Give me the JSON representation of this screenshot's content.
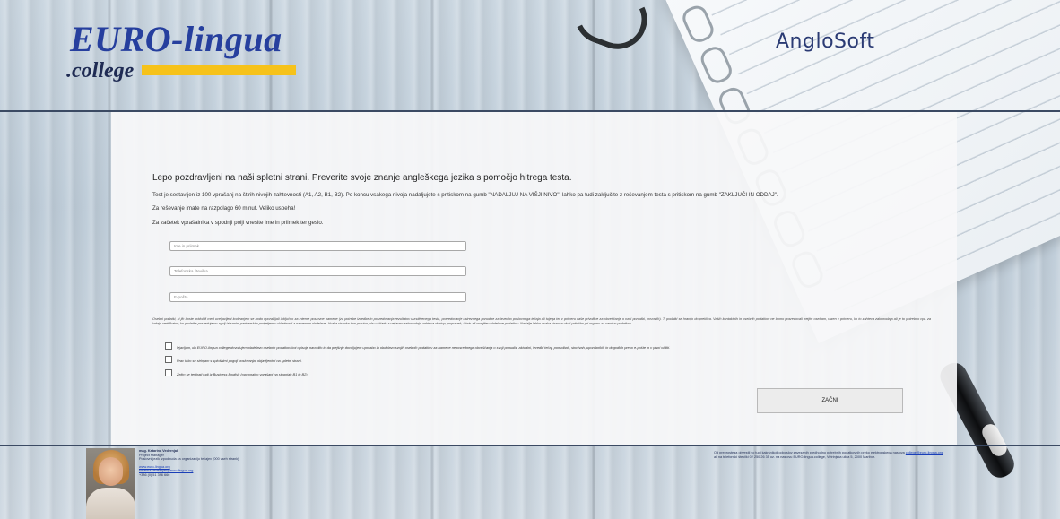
{
  "header": {
    "logo_main": "EURO-lingua",
    "logo_sub": ".college",
    "partner": "AngloSoft"
  },
  "intro": {
    "title": "Lepo pozdravljeni na naši spletni strani. Preverite svoje znanje angleškega jezika s pomočjo hitrega testa.",
    "p1": "Test je sestavljen iz 100 vprašanj na štirih nivojih zahtevnosti (A1, A2, B1, B2). Po koncu vsakega nivoja nadaljujete s pritiskom na gumb \"NADALJUJ NA VIŠJI NIVO\", lahko pa tudi zaključite z reševanjem testa s pritiskom na gumb \"ZAKLJUČI IN ODDAJ\".",
    "p2": "Za reševanje imate na razpolago 60 minut. Veliko uspeha!",
    "p3": "Za začetek vprašalnika v spodnji polji vnesite ime in priimek ter geslo."
  },
  "form": {
    "name_placeholder": "Ime in priimek",
    "phone_placeholder": "Telefonska številka",
    "email_placeholder": "E-pošta",
    "notice": "Osebni podatki, ki jih boste pridobili med uveljavljeni kodiranjem se bodo uporabljali izključno za interne poslovne namene (za potrebe izvedbe in posredovanja rezultatov uvrstitvenega testa, posredovanje ustreznega ponudbe za izvedbo poslovnega tečaja ali tujega ter v primeru vaše privolitve za obveščanje o naši ponudbi, novostih). Ti podatki se hranijo do preklica. Vaših kontaktnih in osebnih podatkov ne bomo posredovali tretjim osebam, razen v primeru, ko to zahteva zakonodaja ali je to potrebno npr. za izdajo certifikatov, ko podatke posredujemo zgolj izbranim partnerskim podjetjem v skladnosti z namenom obdelave. Vsaka stranka ima pravico, da v skladu z veljavno zakonodajo zahteva dostop, popravek, izbris ali omejitev obdelave podatkov. Nadalje lahko vsaka stranka vloži pritožbo pri organu za varstvo podatkov.",
    "consent1": "Izjavljam, da EURO-lingua college dovoljujem obdelavo osebnih podatkov kot opisuje navodilo in da prejšnje dovoljujem uporabo in obdelavo svojih osebnih podatkov za namene neposrednega obveščanja o svoji ponudbi, aktualni, izvedbi tečaj, ponudbah, storitvah, uporabnikih in dogodkih preko e-pošte in v pisni obliki.",
    "consent2": "Prav tako se strinjam s splošnimi pogoji poslovanja, objavljenimi na spletni strani.",
    "consent3": "Želim se testirati tudi iz Business English (opcionalno vprašanj na stopnjah B1 in B2)",
    "start_button": "ZAČNI"
  },
  "footer": {
    "contact_name": "mag. Katarina Vedernjak",
    "contact_role": "Project Manager",
    "contact_desc": "Poslovni jezik izpodbuda za organizacijo tečajev (000 vseh strank)",
    "contact_web": "www.euro-lingua.org",
    "contact_email": "katarina.vedernjak@euro-lingua.org",
    "contact_phone": "+386 (0) 51 396 666",
    "note_text": "Od preprostega obvestil so tudi kakršnikoli odposlov zavezanih predhodno potrebnih podatkovnih preko elektronskega naslova",
    "note_email": "college@euro-lingua.org",
    "note_text2": "ali na telefonski številki 02 250 26 35 oz. na naslovu EURO-lingua.college, Vetrinjska ulica 5, 2000 Maribor."
  }
}
